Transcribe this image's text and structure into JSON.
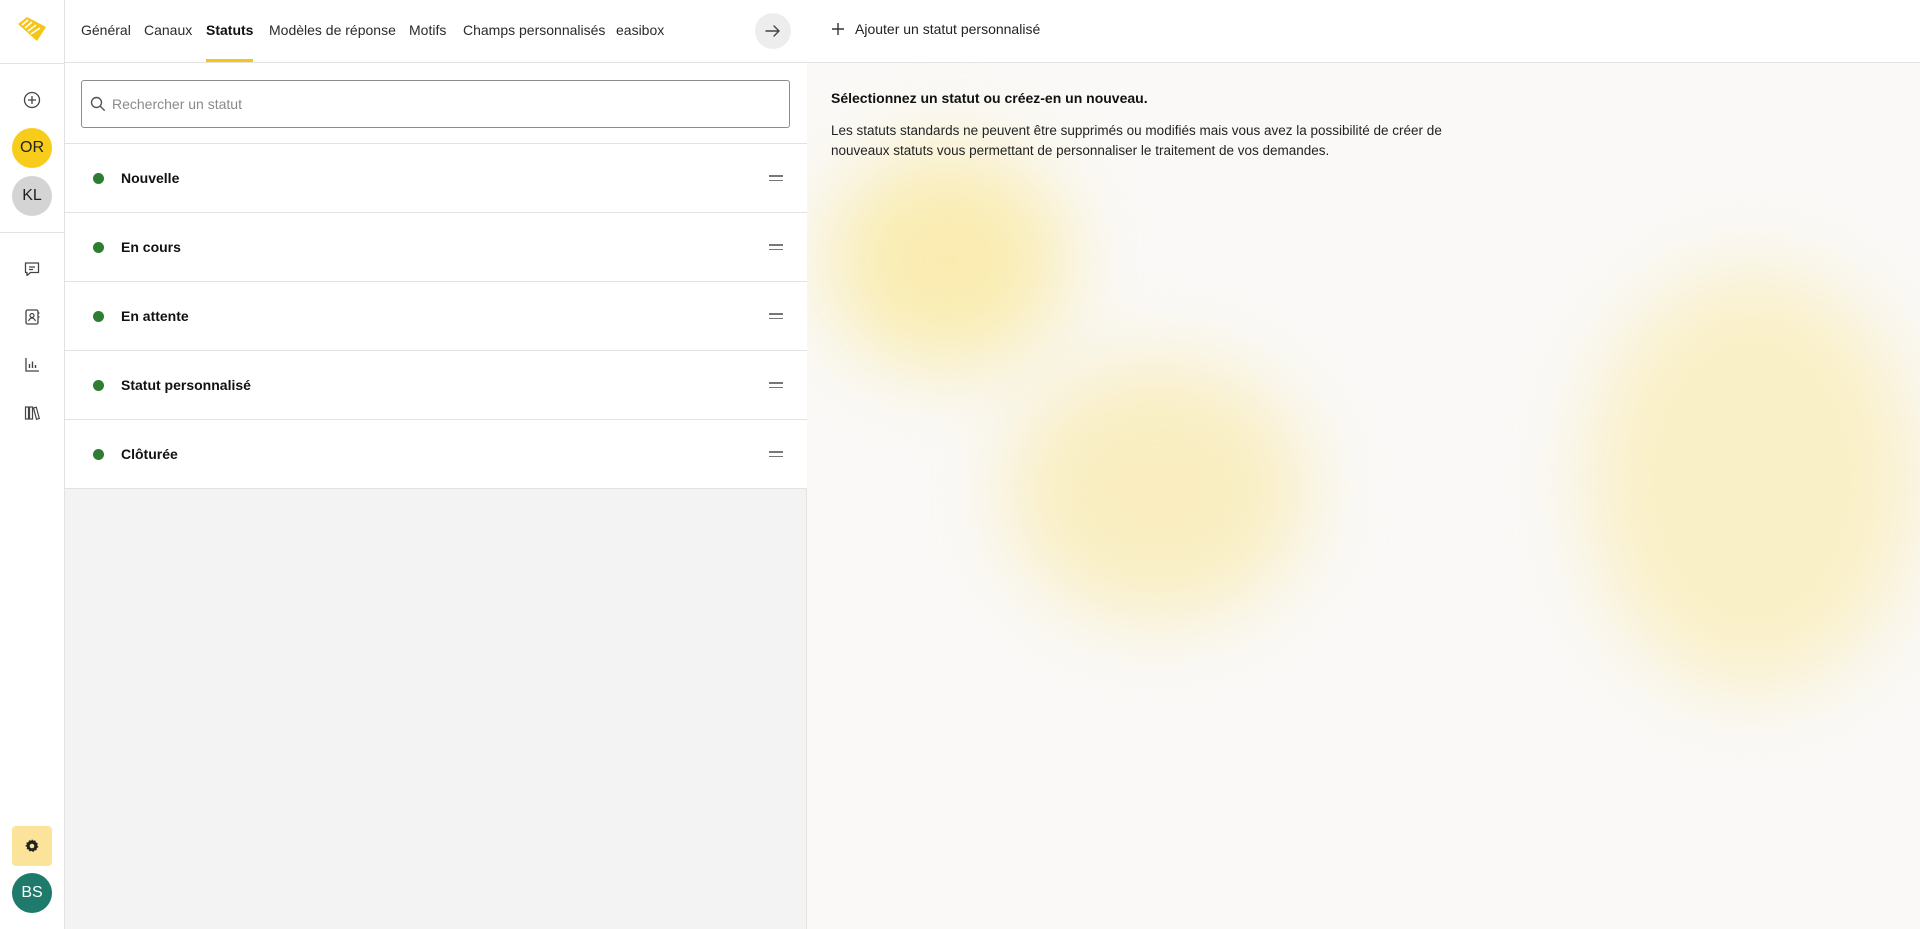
{
  "rail": {
    "avatars": {
      "or": "OR",
      "kl": "KL",
      "bs": "BS"
    }
  },
  "tabs": [
    {
      "label": "Général"
    },
    {
      "label": "Canaux"
    },
    {
      "label": "Statuts"
    },
    {
      "label": "Modèles de réponse"
    },
    {
      "label": "Motifs"
    },
    {
      "label": "Champs personnalisés"
    },
    {
      "label": "easibox"
    }
  ],
  "search": {
    "placeholder": "Rechercher un statut",
    "value": ""
  },
  "statuses": [
    {
      "label": "Nouvelle",
      "color": "#2f7d32"
    },
    {
      "label": "En cours",
      "color": "#2f7d32"
    },
    {
      "label": "En attente",
      "color": "#2f7d32"
    },
    {
      "label": "Statut personnalisé",
      "color": "#2f7d32"
    },
    {
      "label": "Clôturée",
      "color": "#2f7d32"
    }
  ],
  "right": {
    "add_label": "Ajouter un statut personnalisé",
    "intro_title": "Sélectionnez un statut ou créez-en un nouveau.",
    "intro_text": "Les statuts standards ne peuvent être supprimés ou modifiés mais vous avez la possibilité de créer de nouveaux statuts vous permettant de personnaliser le traitement de vos demandes."
  },
  "colors": {
    "accent": "#f5c518",
    "highlight": "#e3000f",
    "status_green": "#2f7d32"
  }
}
